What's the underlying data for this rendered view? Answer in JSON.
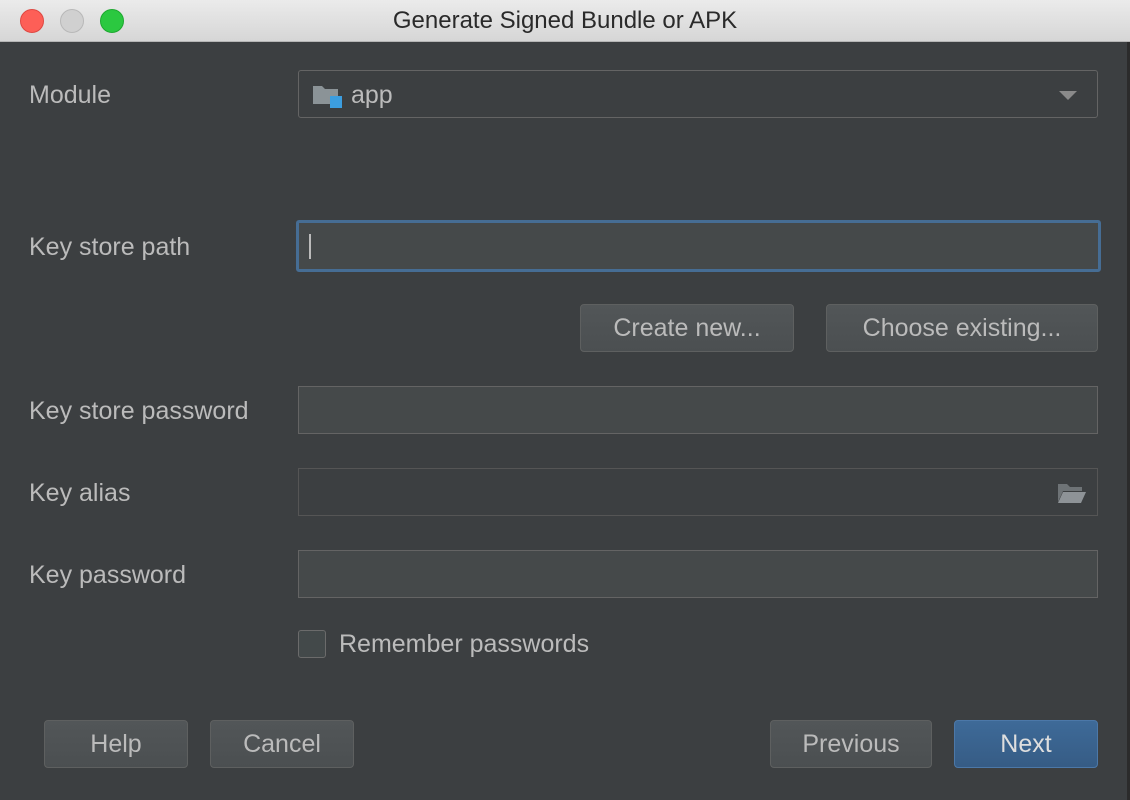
{
  "window": {
    "title": "Generate Signed Bundle or APK"
  },
  "module": {
    "label": "Module",
    "value": "app",
    "icon": "module-folder-icon"
  },
  "keystore": {
    "path_label": "Key store path",
    "path_value": "",
    "create_new_label": "Create new...",
    "choose_existing_label": "Choose existing...",
    "password_label": "Key store password",
    "password_value": ""
  },
  "key": {
    "alias_label": "Key alias",
    "alias_value": "",
    "password_label": "Key password",
    "password_value": ""
  },
  "remember": {
    "label": "Remember passwords",
    "checked": false
  },
  "footer": {
    "help_label": "Help",
    "cancel_label": "Cancel",
    "previous_label": "Previous",
    "next_label": "Next"
  },
  "colors": {
    "background": "#3c3f41",
    "focus_border": "#466d94",
    "primary_button": "#365c85",
    "module_icon_accent": "#3c9ee0"
  }
}
